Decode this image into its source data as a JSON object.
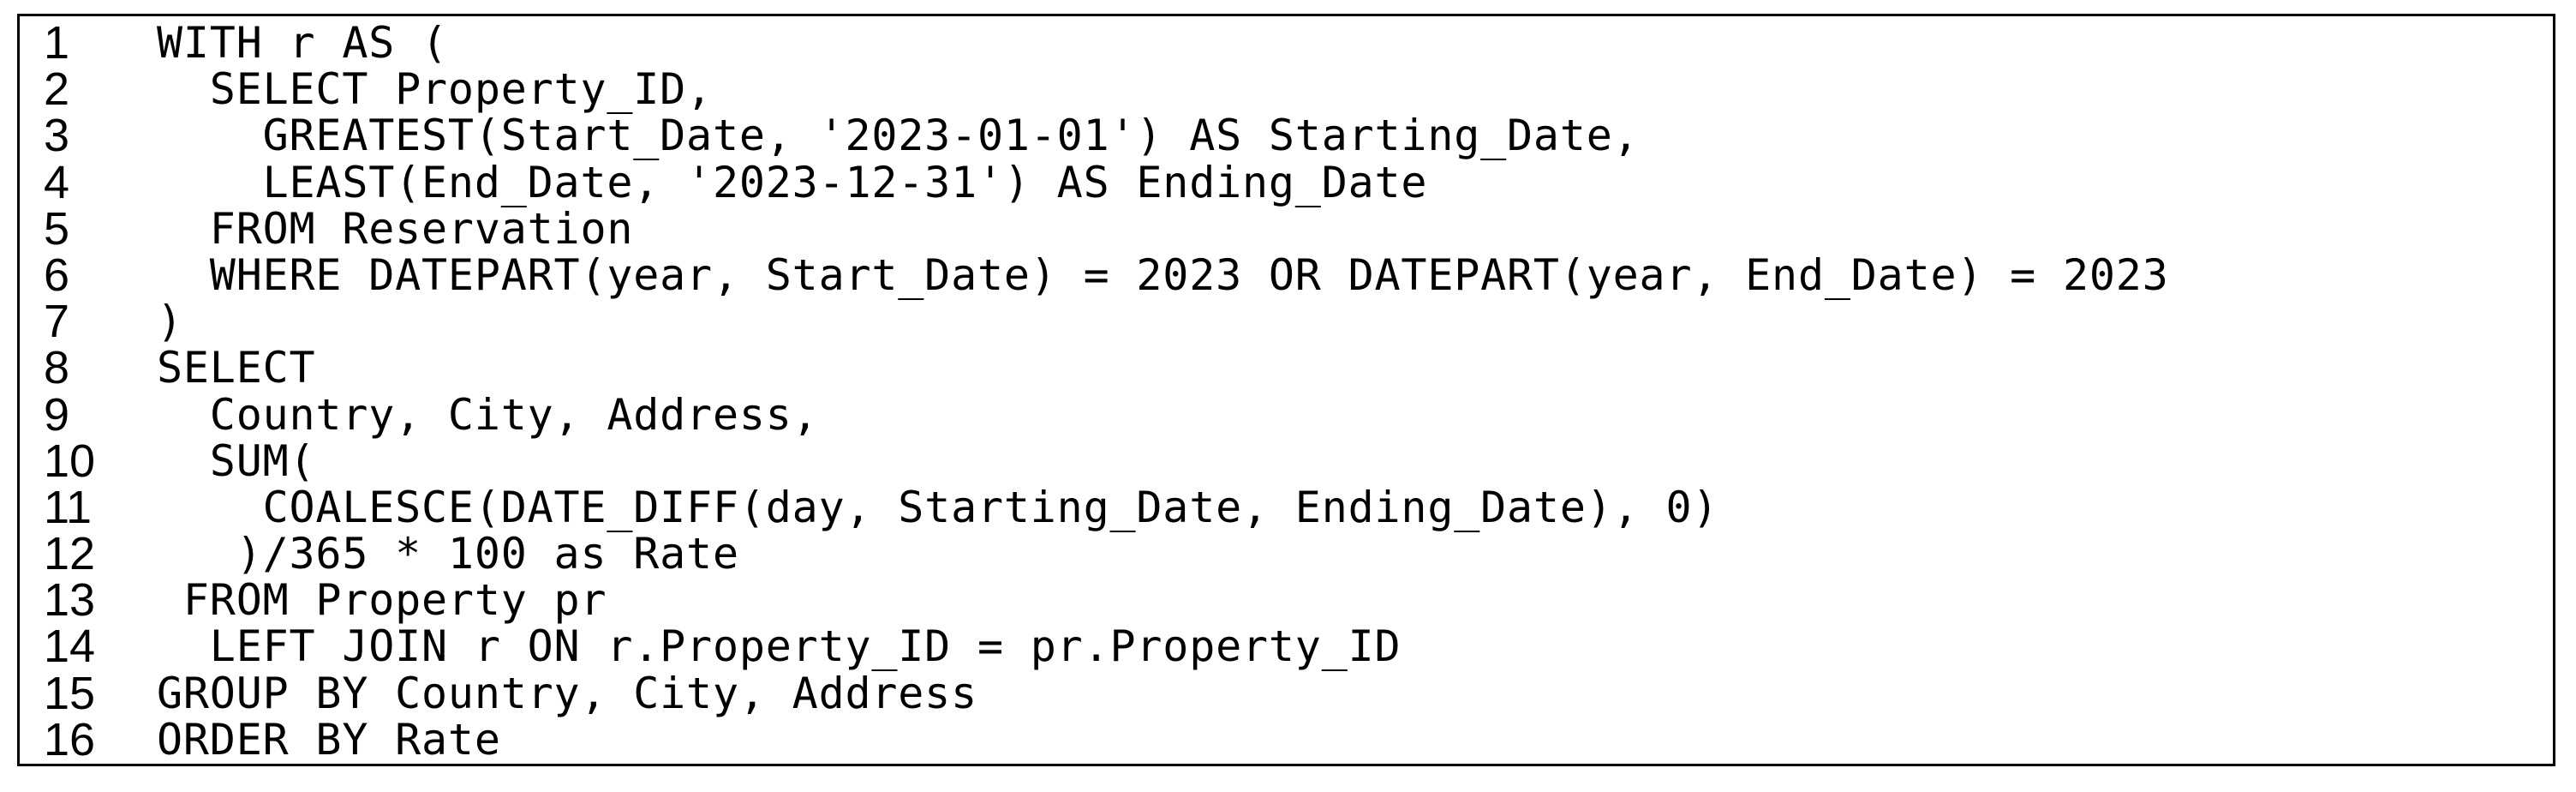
{
  "code": {
    "lines": [
      {
        "number": "1",
        "text": "WITH r AS ("
      },
      {
        "number": "2",
        "text": "  SELECT Property_ID,"
      },
      {
        "number": "3",
        "text": "    GREATEST(Start_Date, '2023-01-01') AS Starting_Date,"
      },
      {
        "number": "4",
        "text": "    LEAST(End_Date, '2023-12-31') AS Ending_Date"
      },
      {
        "number": "5",
        "text": "  FROM Reservation"
      },
      {
        "number": "6",
        "text": "  WHERE DATEPART(year, Start_Date) = 2023 OR DATEPART(year, End_Date) = 2023"
      },
      {
        "number": "7",
        "text": ")"
      },
      {
        "number": "8",
        "text": "SELECT"
      },
      {
        "number": "9",
        "text": "  Country, City, Address,"
      },
      {
        "number": "10",
        "text": "  SUM("
      },
      {
        "number": "11",
        "text": "    COALESCE(DATE_DIFF(day, Starting_Date, Ending_Date), 0)"
      },
      {
        "number": "12",
        "text": "   )/365 * 100 as Rate"
      },
      {
        "number": "13",
        "text": " FROM Property pr"
      },
      {
        "number": "14",
        "text": "  LEFT JOIN r ON r.Property_ID = pr.Property_ID"
      },
      {
        "number": "15",
        "text": "GROUP BY Country, City, Address"
      },
      {
        "number": "16",
        "text": "ORDER BY Rate"
      }
    ]
  }
}
